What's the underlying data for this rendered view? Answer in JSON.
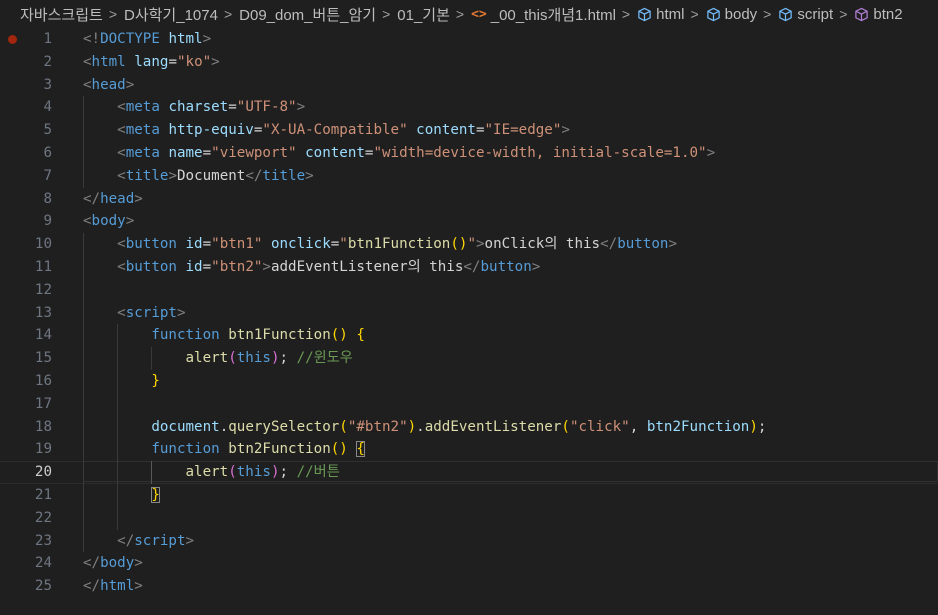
{
  "breadcrumb": [
    {
      "label": "자바스크립트",
      "icon": ""
    },
    {
      "label": "D사학기_1074",
      "icon": ""
    },
    {
      "label": "D09_dom_버튼_암기",
      "icon": ""
    },
    {
      "label": "01_기본",
      "icon": ""
    },
    {
      "label": "_00_this개념1.html",
      "icon": "html-file-icon"
    },
    {
      "label": "html",
      "icon": "element-icon"
    },
    {
      "label": "body",
      "icon": "element-icon"
    },
    {
      "label": "script",
      "icon": "element-icon"
    },
    {
      "label": "btn2",
      "icon": "function-icon"
    }
  ],
  "editor": {
    "current_line": 20,
    "breakpoint_line": 1,
    "lines": [
      {
        "n": "1",
        "tokens": [
          [
            "punc",
            "<!"
          ],
          [
            "doctype",
            "DOCTYPE"
          ],
          [
            "plain",
            " "
          ],
          [
            "attr",
            "html"
          ],
          [
            "punc",
            ">"
          ]
        ]
      },
      {
        "n": "2",
        "tokens": [
          [
            "punc",
            "<"
          ],
          [
            "tag",
            "html"
          ],
          [
            "plain",
            " "
          ],
          [
            "attr",
            "lang"
          ],
          [
            "plain",
            "="
          ],
          [
            "str",
            "\"ko\""
          ],
          [
            "punc",
            ">"
          ]
        ]
      },
      {
        "n": "3",
        "tokens": [
          [
            "punc",
            "<"
          ],
          [
            "tag",
            "head"
          ],
          [
            "punc",
            ">"
          ]
        ]
      },
      {
        "n": "4",
        "tokens": [
          [
            "plain",
            "    "
          ],
          [
            "punc",
            "<"
          ],
          [
            "tag",
            "meta"
          ],
          [
            "plain",
            " "
          ],
          [
            "attr",
            "charset"
          ],
          [
            "plain",
            "="
          ],
          [
            "str",
            "\"UTF-8\""
          ],
          [
            "punc",
            ">"
          ]
        ]
      },
      {
        "n": "5",
        "tokens": [
          [
            "plain",
            "    "
          ],
          [
            "punc",
            "<"
          ],
          [
            "tag",
            "meta"
          ],
          [
            "plain",
            " "
          ],
          [
            "attr",
            "http-equiv"
          ],
          [
            "plain",
            "="
          ],
          [
            "str",
            "\"X-UA-Compatible\""
          ],
          [
            "plain",
            " "
          ],
          [
            "attr",
            "content"
          ],
          [
            "plain",
            "="
          ],
          [
            "str",
            "\"IE=edge\""
          ],
          [
            "punc",
            ">"
          ]
        ]
      },
      {
        "n": "6",
        "tokens": [
          [
            "plain",
            "    "
          ],
          [
            "punc",
            "<"
          ],
          [
            "tag",
            "meta"
          ],
          [
            "plain",
            " "
          ],
          [
            "attr",
            "name"
          ],
          [
            "plain",
            "="
          ],
          [
            "str",
            "\"viewport\""
          ],
          [
            "plain",
            " "
          ],
          [
            "attr",
            "content"
          ],
          [
            "plain",
            "="
          ],
          [
            "str",
            "\"width=device-width, initial-scale=1.0\""
          ],
          [
            "punc",
            ">"
          ]
        ]
      },
      {
        "n": "7",
        "tokens": [
          [
            "plain",
            "    "
          ],
          [
            "punc",
            "<"
          ],
          [
            "tag",
            "title"
          ],
          [
            "punc",
            ">"
          ],
          [
            "text",
            "Document"
          ],
          [
            "punc",
            "</"
          ],
          [
            "tag",
            "title"
          ],
          [
            "punc",
            ">"
          ]
        ]
      },
      {
        "n": "8",
        "tokens": [
          [
            "punc",
            "</"
          ],
          [
            "tag",
            "head"
          ],
          [
            "punc",
            ">"
          ]
        ]
      },
      {
        "n": "9",
        "tokens": [
          [
            "punc",
            "<"
          ],
          [
            "tag",
            "body"
          ],
          [
            "punc",
            ">"
          ]
        ]
      },
      {
        "n": "10",
        "tokens": [
          [
            "plain",
            "    "
          ],
          [
            "punc",
            "<"
          ],
          [
            "tag",
            "button"
          ],
          [
            "plain",
            " "
          ],
          [
            "attr",
            "id"
          ],
          [
            "plain",
            "="
          ],
          [
            "str",
            "\"btn1\""
          ],
          [
            "plain",
            " "
          ],
          [
            "attr",
            "onclick"
          ],
          [
            "plain",
            "="
          ],
          [
            "str",
            "\""
          ],
          [
            "fn",
            "btn1Function"
          ],
          [
            "brace-y",
            "()"
          ],
          [
            "str",
            "\""
          ],
          [
            "punc",
            ">"
          ],
          [
            "text",
            "onClick의 this"
          ],
          [
            "punc",
            "</"
          ],
          [
            "tag",
            "button"
          ],
          [
            "punc",
            ">"
          ]
        ]
      },
      {
        "n": "11",
        "tokens": [
          [
            "plain",
            "    "
          ],
          [
            "punc",
            "<"
          ],
          [
            "tag",
            "button"
          ],
          [
            "plain",
            " "
          ],
          [
            "attr",
            "id"
          ],
          [
            "plain",
            "="
          ],
          [
            "str",
            "\"btn2\""
          ],
          [
            "punc",
            ">"
          ],
          [
            "text",
            "addEventListener의 this"
          ],
          [
            "punc",
            "</"
          ],
          [
            "tag",
            "button"
          ],
          [
            "punc",
            ">"
          ]
        ]
      },
      {
        "n": "12",
        "tokens": []
      },
      {
        "n": "13",
        "tokens": [
          [
            "plain",
            "    "
          ],
          [
            "punc",
            "<"
          ],
          [
            "tag",
            "script"
          ],
          [
            "punc",
            ">"
          ]
        ]
      },
      {
        "n": "14",
        "tokens": [
          [
            "plain",
            "        "
          ],
          [
            "kw",
            "function"
          ],
          [
            "plain",
            " "
          ],
          [
            "fn",
            "btn1Function"
          ],
          [
            "brace-y",
            "()"
          ],
          [
            "plain",
            " "
          ],
          [
            "brace-y",
            "{"
          ]
        ]
      },
      {
        "n": "15",
        "tokens": [
          [
            "plain",
            "            "
          ],
          [
            "fn",
            "alert"
          ],
          [
            "brace-p",
            "("
          ],
          [
            "kw",
            "this"
          ],
          [
            "brace-p",
            ")"
          ],
          [
            "plain",
            "; "
          ],
          [
            "comment",
            "//윈도우"
          ]
        ]
      },
      {
        "n": "16",
        "tokens": [
          [
            "plain",
            "        "
          ],
          [
            "brace-y",
            "}"
          ]
        ]
      },
      {
        "n": "17",
        "tokens": []
      },
      {
        "n": "18",
        "tokens": [
          [
            "plain",
            "        "
          ],
          [
            "var",
            "document"
          ],
          [
            "plain",
            "."
          ],
          [
            "fn",
            "querySelector"
          ],
          [
            "brace-y",
            "("
          ],
          [
            "str",
            "\"#btn2\""
          ],
          [
            "brace-y",
            ")"
          ],
          [
            "plain",
            "."
          ],
          [
            "fn",
            "addEventListener"
          ],
          [
            "brace-y",
            "("
          ],
          [
            "str",
            "\"click\""
          ],
          [
            "plain",
            ", "
          ],
          [
            "var",
            "btn2Function"
          ],
          [
            "brace-y",
            ")"
          ],
          [
            "plain",
            ";"
          ]
        ]
      },
      {
        "n": "19",
        "tokens": [
          [
            "plain",
            "        "
          ],
          [
            "kw",
            "function"
          ],
          [
            "plain",
            " "
          ],
          [
            "fn",
            "btn2Function"
          ],
          [
            "brace-y",
            "()"
          ],
          [
            "plain",
            " "
          ],
          [
            "brace-y-match",
            "{"
          ]
        ]
      },
      {
        "n": "20",
        "tokens": [
          [
            "plain",
            "            "
          ],
          [
            "fn",
            "alert"
          ],
          [
            "brace-p",
            "("
          ],
          [
            "kw",
            "this"
          ],
          [
            "brace-p",
            ")"
          ],
          [
            "plain",
            "; "
          ],
          [
            "comment",
            "//버튼"
          ]
        ]
      },
      {
        "n": "21",
        "tokens": [
          [
            "plain",
            "        "
          ],
          [
            "brace-y-match",
            "}"
          ]
        ]
      },
      {
        "n": "22",
        "tokens": []
      },
      {
        "n": "23",
        "tokens": [
          [
            "plain",
            "    "
          ],
          [
            "punc",
            "</"
          ],
          [
            "tag",
            "script"
          ],
          [
            "punc",
            ">"
          ]
        ]
      },
      {
        "n": "24",
        "tokens": [
          [
            "punc",
            "</"
          ],
          [
            "tag",
            "body"
          ],
          [
            "punc",
            ">"
          ]
        ]
      },
      {
        "n": "25",
        "tokens": [
          [
            "punc",
            "</"
          ],
          [
            "tag",
            "html"
          ],
          [
            "punc",
            ">"
          ]
        ]
      }
    ]
  },
  "colors": {
    "background": "#1f1f1f",
    "breakpoint": "#a1260d",
    "line_number": "#6e7681"
  }
}
